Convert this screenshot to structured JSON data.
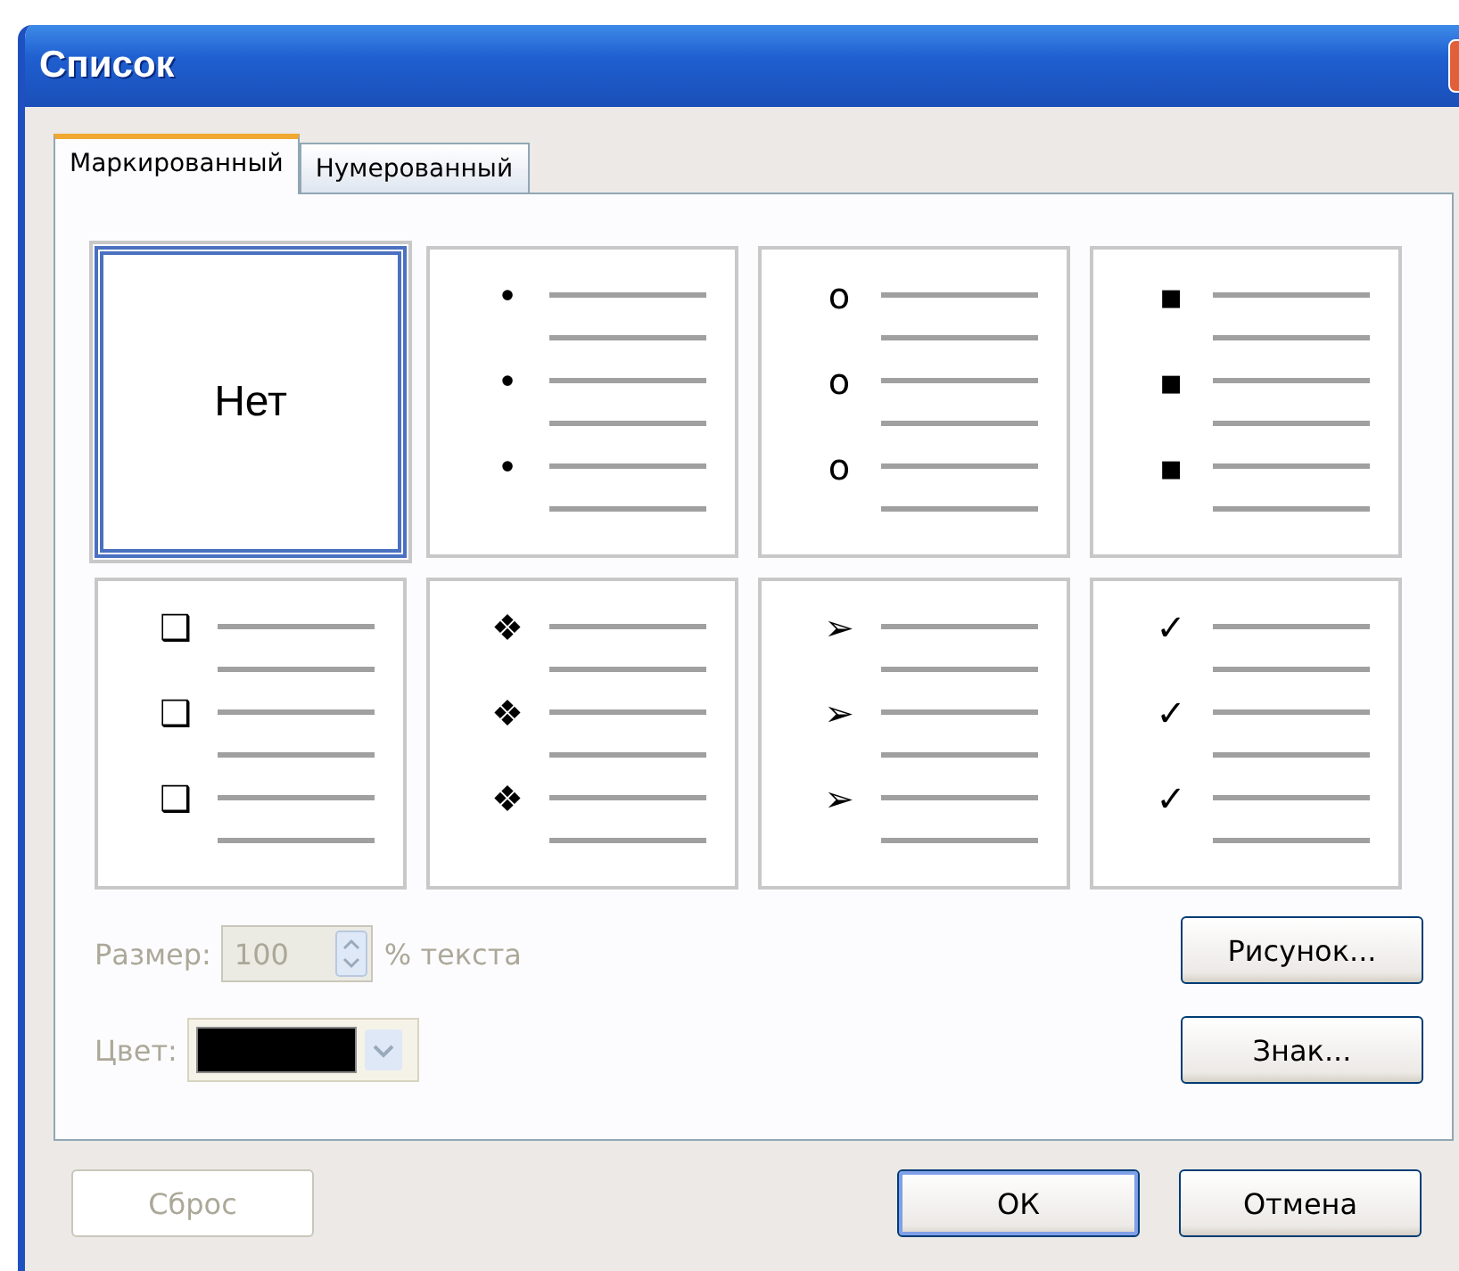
{
  "window": {
    "title": "Список"
  },
  "tabs": [
    {
      "label": "Маркированный",
      "selected": true
    },
    {
      "label": "Нумерованный",
      "selected": false
    }
  ],
  "bullets": [
    {
      "kind": "none",
      "label": "Нет",
      "selected": true
    },
    {
      "kind": "bullet",
      "symbols": [
        "•",
        "•",
        "•"
      ],
      "selected": false
    },
    {
      "kind": "bullet",
      "symbols": [
        "o",
        "o",
        "o"
      ],
      "selected": false
    },
    {
      "kind": "bullet",
      "symbols": [
        "▪",
        "▪",
        "▪"
      ],
      "selected": false
    },
    {
      "kind": "bullet",
      "symbols": [
        "❑",
        "❑",
        "❑"
      ],
      "selected": false
    },
    {
      "kind": "bullet",
      "symbols": [
        "❖",
        "❖",
        "❖"
      ],
      "selected": false
    },
    {
      "kind": "bullet",
      "symbols": [
        "➢",
        "➢",
        "➢"
      ],
      "selected": false
    },
    {
      "kind": "bullet",
      "symbols": [
        "✓",
        "✓",
        "✓"
      ],
      "selected": false
    }
  ],
  "size": {
    "label": "Размер:",
    "value": "100",
    "suffix": "% текста",
    "disabled": true
  },
  "color": {
    "label": "Цвет:",
    "disabled": true
  },
  "side_buttons": [
    "Рисунок...",
    "Знак..."
  ],
  "reset_button": {
    "label": "Сброс",
    "disabled": true
  },
  "buttons": [
    {
      "label": "ОК",
      "default": true
    },
    {
      "label": "Отмена",
      "default": false
    }
  ]
}
